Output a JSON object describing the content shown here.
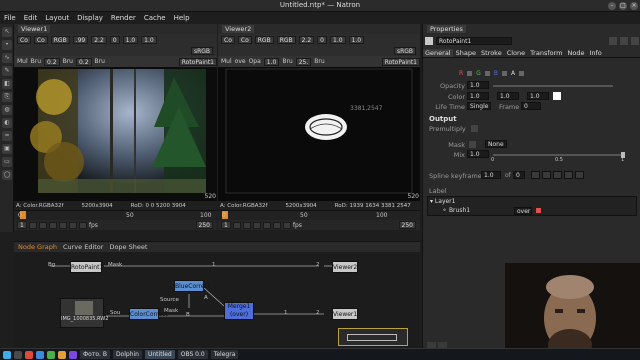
{
  "window": {
    "title": "Untitled.ntp* — Natron"
  },
  "menu": [
    "File",
    "Edit",
    "Layout",
    "Display",
    "Render",
    "Cache",
    "Help"
  ],
  "viewer1": {
    "tab": "Viewer1",
    "row1": [
      "Co",
      "Co",
      "RGB",
      ".99",
      "2.2",
      "0",
      "1.0",
      "1.0"
    ],
    "row2_fields": [
      "Mul",
      "Bru",
      "0.2",
      "Bru",
      "0.2",
      "Bru",
      "RotoPaint1"
    ],
    "colorspace": "sRGB",
    "status": {
      "format": "A: Color.RGBA32f",
      "size": "5200x3904",
      "rod": "RoD: 0 0 5200 3904"
    },
    "frame_tag": "520"
  },
  "viewer2": {
    "tab": "Viewer2",
    "row1": [
      "Co",
      "Co",
      "RGB",
      "RGB",
      "2.2",
      "0",
      "1.0",
      "1.0"
    ],
    "row2_fields": [
      "Mul",
      "ove",
      "Opa",
      "1.0",
      "Bru",
      "25.",
      "Bru",
      "RotoPaint1"
    ],
    "colorspace": "sRGB",
    "coords": "3381,2547",
    "status": {
      "format": "A: Color.RGBA32f",
      "size": "5200x3904",
      "rod": "RoD: 1939 1634 3381 2547"
    },
    "frame_tag": "520"
  },
  "timeline1": {
    "ticks": [
      "0",
      "50",
      "100"
    ],
    "start": "1",
    "end": "250",
    "fps_label": "fps"
  },
  "timeline2": {
    "ticks": [
      "0",
      "50",
      "100"
    ],
    "start": "1",
    "end": "250",
    "fps_label": "fps"
  },
  "nodegraph": {
    "tabs": [
      "Node Graph",
      "Curve Editor",
      "Dope Sheet"
    ],
    "nodes": {
      "rotopaint": "RotoPaint1",
      "viewer2": "Viewer2",
      "bluecorrect": "BlueCorrect",
      "read": "IMG_1000835.RW2",
      "colorcorrect": "ColorCorrect",
      "merge": "Merge1\n(over)",
      "viewer1": "Viewer1"
    },
    "labels": {
      "bg": "Bg",
      "mask": "Mask",
      "source": "Source",
      "mask2": "Mask",
      "a": "A",
      "b": "B",
      "in1": "1",
      "in2": "2",
      "sou": "Sou",
      "in1b": "1",
      "in2b": "2"
    }
  },
  "properties": {
    "header": "Properties",
    "node_name": "RotoPaint1",
    "tabs": [
      "General",
      "Shape",
      "Stroke",
      "Clone",
      "Transform",
      "Node",
      "Info"
    ],
    "channels": [
      "R",
      "G",
      "B",
      "A"
    ],
    "opacity": {
      "label": "Opacity",
      "value": "1.0"
    },
    "color": {
      "label": "Color",
      "values": [
        "1.0",
        "1.0",
        "1.0"
      ]
    },
    "lifetime": {
      "label": "Life Time",
      "mode": "Single",
      "frame_label": "Frame",
      "frame": "0"
    },
    "output": {
      "header": "Output",
      "premultiply": "Premultiply"
    },
    "mask": {
      "label": "Mask",
      "value": "None"
    },
    "mix": {
      "label": "Mix",
      "value": "1.0",
      "ticks": [
        "0",
        "0.5",
        "1"
      ]
    },
    "spline": {
      "label": "Spline keyframe",
      "value": "1.0",
      "of": "of",
      "count": "0"
    },
    "layers": {
      "label": "Label",
      "layer": "Layer1",
      "brush": "Brush1",
      "blend": "over"
    }
  },
  "taskbar": {
    "tasks": [
      "Фото. В",
      "Dolphin",
      "Untitled",
      "OBS 0.0",
      "Telegra"
    ],
    "clock": "..."
  },
  "colors": {
    "node_roto": "#c8c8c8",
    "node_blue": "#5b8fd1",
    "node_merge": "#4e6edb",
    "node_viewer": "#c8c8c8",
    "accent_orange": "#e08a2a"
  }
}
